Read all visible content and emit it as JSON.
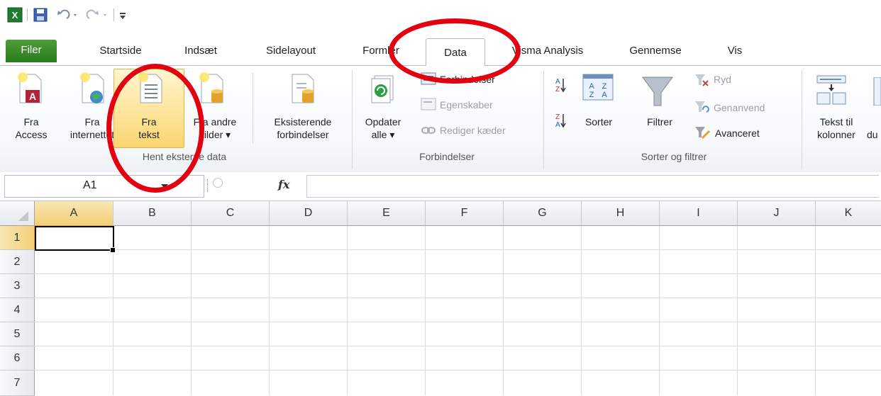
{
  "quick_access": {
    "icons": [
      "excel-logo-icon",
      "save-icon",
      "undo-icon",
      "redo-icon",
      "customize-qat-icon"
    ]
  },
  "tabs": [
    {
      "label": "Filer"
    },
    {
      "label": "Startside"
    },
    {
      "label": "Indsæt"
    },
    {
      "label": "Sidelayout"
    },
    {
      "label": "Formler"
    },
    {
      "label": "Data"
    },
    {
      "label": "Visma Analysis"
    },
    {
      "label": "Gennemse"
    },
    {
      "label": "Vis"
    }
  ],
  "ribbon": {
    "external": {
      "group_label": "Hent eksterne data",
      "fra_access": "Fra\nAccess",
      "fra_internettet": "Fra\ninternettet",
      "fra_tekst": "Fra\ntekst",
      "fra_andre": "Fra andre\nkilder ▾",
      "eksisterende": "Eksisterende\nforbindelser"
    },
    "connections": {
      "group_label": "Forbindelser",
      "opdater": "Opdater\nalle ▾",
      "forbindelser": "Forbindelser",
      "egenskaber": "Egenskaber",
      "rediger": "Rediger kæder"
    },
    "sort": {
      "group_label": "Sorter og filtrer",
      "sorter": "Sorter",
      "filtrer": "Filtrer",
      "ryd": "Ryd",
      "genanvend": "Genanvend",
      "avanceret": "Avanceret"
    },
    "tools": {
      "tekst_til": "Tekst til\nkolonner",
      "du": "du"
    }
  },
  "formula_bar": {
    "name_box": "A1",
    "fx": "fx",
    "formula": ""
  },
  "grid": {
    "columns": [
      "A",
      "B",
      "C",
      "D",
      "E",
      "F",
      "G",
      "H",
      "I",
      "J",
      "K"
    ],
    "rows": [
      "1",
      "2",
      "3",
      "4",
      "5",
      "6",
      "7"
    ],
    "selected_cell": "A1"
  },
  "colors": {
    "file_tab": "#2a7a1e",
    "highlight_circle": "#e3000f",
    "selected_header": "#f6d88f"
  }
}
